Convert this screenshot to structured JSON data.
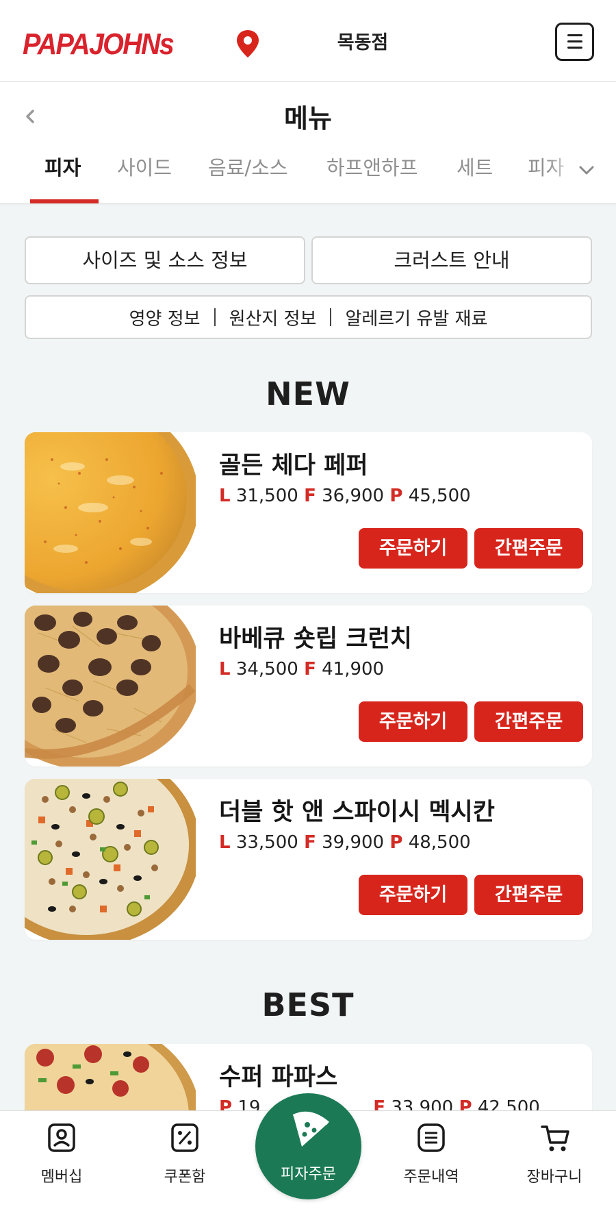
{
  "header": {
    "logo": "PAPAJOHNs",
    "store": "목동점"
  },
  "page": {
    "title": "메뉴"
  },
  "tabs": [
    {
      "label": "피자",
      "active": true
    },
    {
      "label": "사이드",
      "active": false
    },
    {
      "label": "음료/소스",
      "active": false
    },
    {
      "label": "하프앤하프",
      "active": false
    },
    {
      "label": "세트",
      "active": false
    },
    {
      "label": "피자",
      "active": false
    }
  ],
  "info": {
    "size_sauce": "사이즈 및 소스 정보",
    "crust": "크러스트 안내",
    "nutrition": "영양 정보",
    "origin": "원산지 정보",
    "allergy": "알레르기 유발 재료"
  },
  "sections": {
    "new": "NEW",
    "best": "BEST"
  },
  "products": [
    {
      "name": "골든 체다 페퍼",
      "prices": [
        {
          "size": "L",
          "price": "31,500"
        },
        {
          "size": "F",
          "price": "36,900"
        },
        {
          "size": "P",
          "price": "45,500"
        }
      ],
      "order": "주문하기",
      "quick": "간편주문"
    },
    {
      "name": "바베큐 숏립 크런치",
      "prices": [
        {
          "size": "L",
          "price": "34,500"
        },
        {
          "size": "F",
          "price": "41,900"
        }
      ],
      "order": "주문하기",
      "quick": "간편주문"
    },
    {
      "name": "더블 핫 앤 스파이시 멕시칸",
      "prices": [
        {
          "size": "L",
          "price": "33,500"
        },
        {
          "size": "F",
          "price": "39,900"
        },
        {
          "size": "P",
          "price": "48,500"
        }
      ],
      "order": "주문하기",
      "quick": "간편주문"
    },
    {
      "name": "수퍼 파파스",
      "prices": [
        {
          "size": "F",
          "price": "33,900"
        },
        {
          "size": "P",
          "price": "42,500"
        }
      ]
    }
  ],
  "nav": {
    "membership": "멤버십",
    "coupon": "쿠폰함",
    "pizza_order": "피자주문",
    "order_history": "주문내역",
    "cart": "장바구니"
  },
  "colors": {
    "brand_red": "#d8251c",
    "nav_green": "#1b7a55",
    "background": "#f1f5f5"
  },
  "icons": [
    "location-pin-icon",
    "hamburger-menu-icon",
    "back-chevron-icon",
    "chevron-down-icon",
    "membership-icon",
    "coupon-icon",
    "pizza-slice-icon",
    "order-list-icon",
    "cart-icon"
  ]
}
